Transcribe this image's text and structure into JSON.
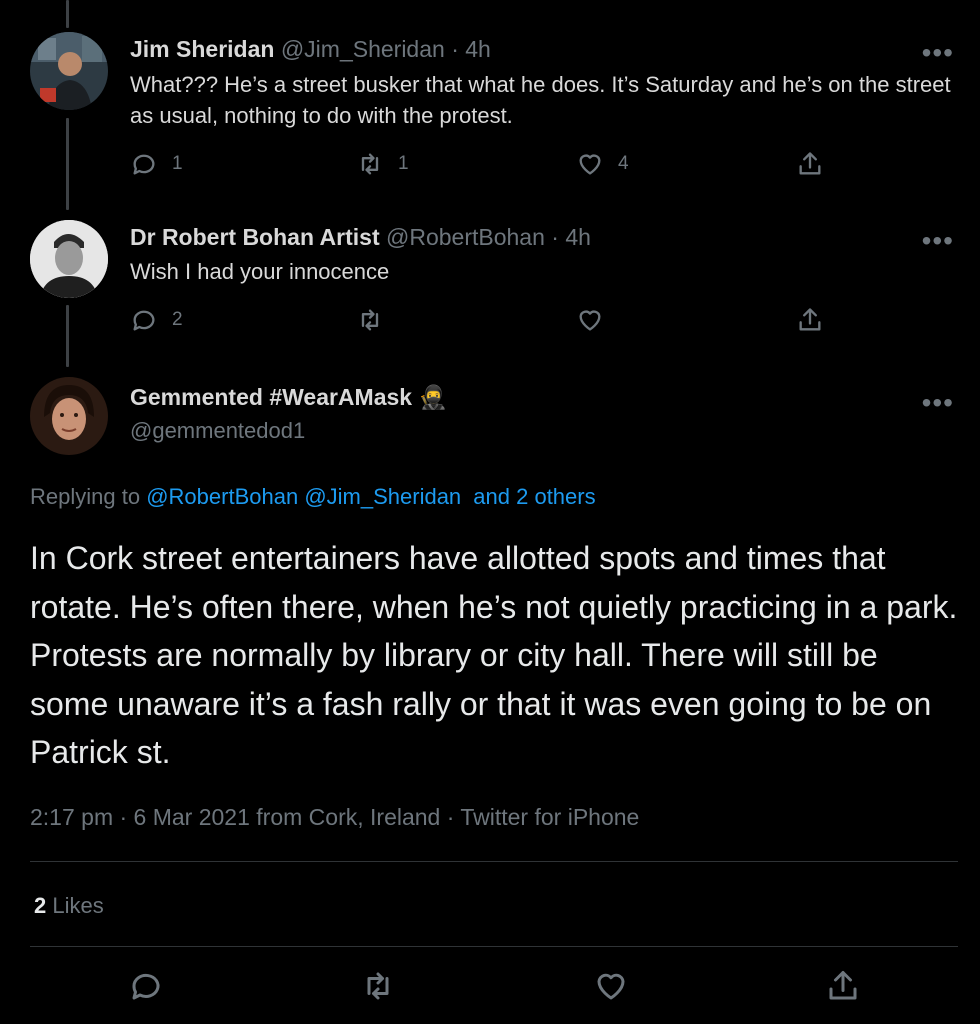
{
  "tweets": [
    {
      "name": "Jim Sheridan",
      "handle": "@Jim_Sheridan",
      "dot": "·",
      "time": "4h",
      "text": "What??? He’s a street busker that what he does. It’s Saturday and he’s on the street as usual, nothing to do with the protest.",
      "more": "•••",
      "replies": "1",
      "retweets": "1",
      "likes": "4"
    },
    {
      "name": "Dr Robert Bohan Artist",
      "handle": "@RobertBohan",
      "dot": "·",
      "time": "4h",
      "text": "Wish I had your innocence",
      "more": "•••",
      "replies": "2",
      "retweets": "",
      "likes": ""
    }
  ],
  "main": {
    "name": "Gemmented #WearAMask 🥷",
    "handle": "@gemmentedod1",
    "more": "•••",
    "replying_prefix": "Replying to",
    "replying_to_1": "@RobertBohan",
    "replying_to_2": "@Jim_Sheridan",
    "replying_others": "and 2 others",
    "text": "In Cork street entertainers have allotted spots and times that rotate. He’s often there, when he’s not quietly practicing in a park. Protests are normally by library or city hall. There will still be some unaware it’s a fash rally or that it was even going to be on Patrick st.",
    "meta": "2:17 pm · 6 Mar 2021 from Cork, Ireland · Twitter for iPhone",
    "likes_count": "2",
    "likes_label": "Likes"
  },
  "icons": {
    "reply": "reply-icon",
    "retweet": "retweet-icon",
    "like": "heart-icon",
    "share": "share-icon",
    "more": "more-icon"
  },
  "colors": {
    "background": "#000000",
    "text": "#d9d9d9",
    "muted": "#6e767d",
    "link": "#1d9bf0",
    "divider": "#2f3336"
  }
}
